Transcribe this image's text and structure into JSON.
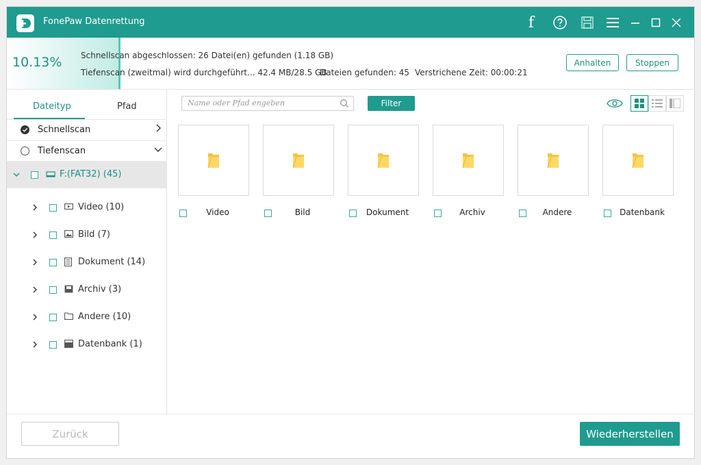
{
  "app": {
    "title": "FonePaw Datenrettung"
  },
  "status": {
    "percent": "10.13%",
    "progress_fraction": 0.1013,
    "line1": "Schnellscan abgeschlossen: 26 Datei(en) gefunden (1.18 GB)",
    "line2_a": "Tiefenscan (zweitmal) wird durchgeführt... 42.4 MB/28.5 GB",
    "line2_b": "Dateien gefunden: 45",
    "line2_c": "Verstrichene Zeit: 00:00:21",
    "pause_label": "Anhalten",
    "stop_label": "Stoppen"
  },
  "left": {
    "tabs": [
      {
        "label": "Dateityp",
        "active": true
      },
      {
        "label": "Pfad",
        "active": false
      }
    ],
    "scans": [
      {
        "label": "Schnellscan",
        "checked": true
      },
      {
        "label": "Tiefenscan",
        "checked": false
      }
    ],
    "drive": {
      "label": "F:(FAT32) (45)"
    },
    "items": [
      {
        "label": "Video (10)",
        "icon": "video-icon"
      },
      {
        "label": "Bild (7)",
        "icon": "image-icon"
      },
      {
        "label": "Dokument (14)",
        "icon": "document-icon"
      },
      {
        "label": "Archiv (3)",
        "icon": "archive-icon"
      },
      {
        "label": "Andere (10)",
        "icon": "folder-icon"
      },
      {
        "label": "Datenbank (1)",
        "icon": "database-icon"
      }
    ]
  },
  "toolbar": {
    "search_placeholder": "Name oder Pfad engeben",
    "filter_label": "Filter"
  },
  "tiles": [
    {
      "label": "Video"
    },
    {
      "label": "Bild"
    },
    {
      "label": "Dokument"
    },
    {
      "label": "Archiv"
    },
    {
      "label": "Andere"
    },
    {
      "label": "Datenbank"
    }
  ],
  "bottom": {
    "back_label": "Zurück",
    "restore_label": "Wiederherstellen"
  },
  "colors": {
    "accent": "#1f9b8f",
    "folder": "#f5c542"
  }
}
